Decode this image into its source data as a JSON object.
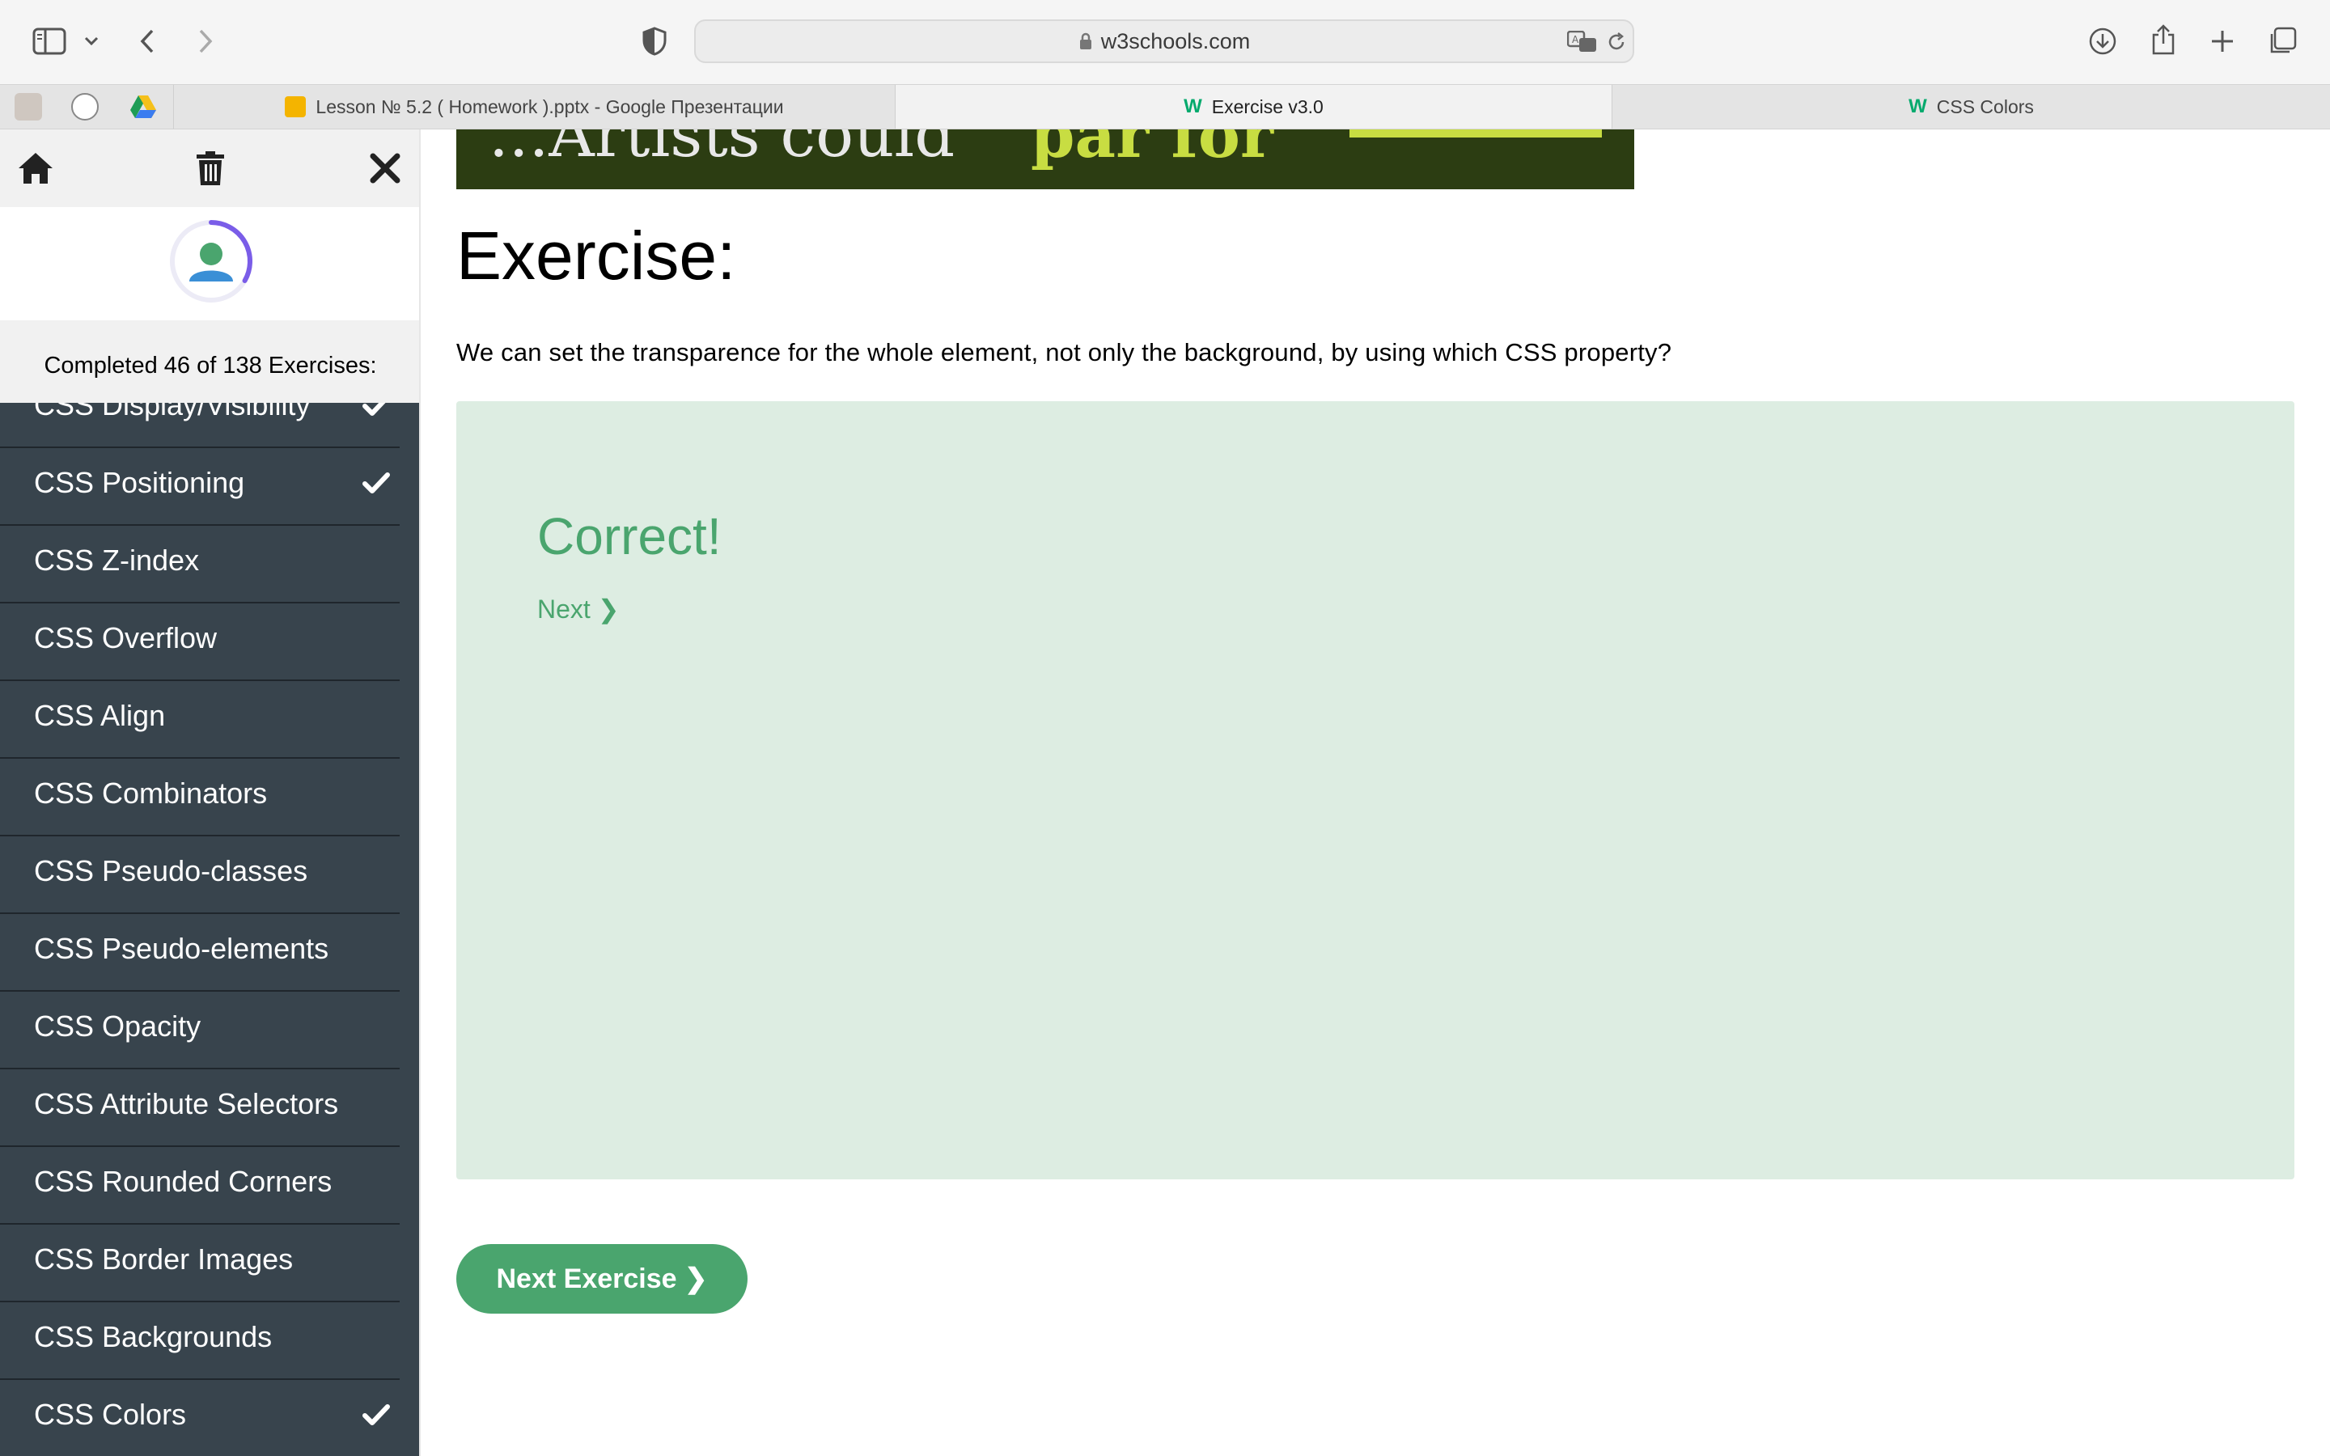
{
  "browser": {
    "url": "w3schools.com",
    "tabs": [
      {
        "title": "Lesson № 5.2 ( Homework ).pptx - Google Презентации",
        "active": false
      },
      {
        "title": "Exercise v3.0",
        "active": true
      },
      {
        "title": "CSS Colors",
        "active": false
      }
    ]
  },
  "sidebar": {
    "progress": {
      "text": "Completed 46 of 138 Exercises:",
      "completed": 46,
      "total": 138
    },
    "items": [
      {
        "label": "CSS Display/Visibility",
        "done": true
      },
      {
        "label": "CSS Positioning",
        "done": true
      },
      {
        "label": "CSS Z-index",
        "done": false
      },
      {
        "label": "CSS Overflow",
        "done": false
      },
      {
        "label": "CSS Align",
        "done": false
      },
      {
        "label": "CSS Combinators",
        "done": false
      },
      {
        "label": "CSS Pseudo-classes",
        "done": false
      },
      {
        "label": "CSS Pseudo-elements",
        "done": false
      },
      {
        "label": "CSS Opacity",
        "done": false
      },
      {
        "label": "CSS Attribute Selectors",
        "done": false
      },
      {
        "label": "CSS Rounded Corners",
        "done": false
      },
      {
        "label": "CSS Border Images",
        "done": false
      },
      {
        "label": "CSS Backgrounds",
        "done": false
      },
      {
        "label": "CSS Colors",
        "done": true
      }
    ]
  },
  "ad": {
    "text_left": "...Artists could",
    "text_right": "par for"
  },
  "main": {
    "heading": "Exercise:",
    "question": "We can set the transparence for the whole element, not only the background, by using which CSS property?",
    "result": "Correct!",
    "next_link": "Next ❯",
    "next_exercise": "Next Exercise ❯"
  },
  "colors": {
    "accent": "#4aa56e",
    "sidebar_bg": "#38444d",
    "answer_bg": "#ddede2",
    "ad_bg": "#2c3d12"
  }
}
